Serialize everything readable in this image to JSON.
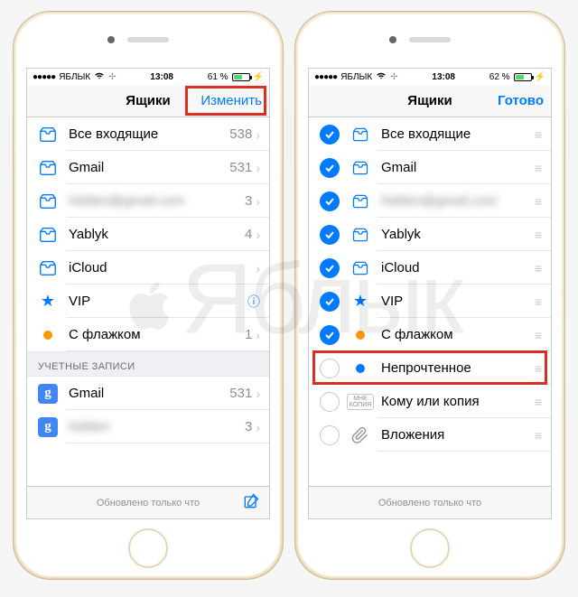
{
  "watermark": "Яблык",
  "left": {
    "status": {
      "carrier": "ЯБЛЫК",
      "time": "13:08",
      "battery": "61 %"
    },
    "nav": {
      "title": "Ящики",
      "right": "Изменить"
    },
    "mailboxes": [
      {
        "label": "Все входящие",
        "count": "538",
        "icon": "inbox"
      },
      {
        "label": "Gmail",
        "count": "531",
        "icon": "inbox"
      },
      {
        "label": "hidden@gmail.com",
        "count": "3",
        "icon": "inbox",
        "blurred": true
      },
      {
        "label": "Yablyk",
        "count": "4",
        "icon": "inbox"
      },
      {
        "label": "iCloud",
        "count": "",
        "icon": "inbox"
      },
      {
        "label": "VIP",
        "count": "",
        "icon": "star"
      },
      {
        "label": "С флажком",
        "count": "1",
        "icon": "flag"
      }
    ],
    "accounts_header": "УЧЕТНЫЕ ЗАПИСИ",
    "accounts": [
      {
        "label": "Gmail",
        "count": "531"
      },
      {
        "label": "hidden",
        "count": "3",
        "blurred": true
      }
    ],
    "toolbar": {
      "status": "Обновлено только что"
    }
  },
  "right": {
    "status": {
      "carrier": "ЯБЛЫК",
      "time": "13:08",
      "battery": "62 %"
    },
    "nav": {
      "title": "Ящики",
      "right": "Готово"
    },
    "items": [
      {
        "label": "Все входящие",
        "icon": "inbox",
        "checked": true
      },
      {
        "label": "Gmail",
        "icon": "inbox",
        "checked": true
      },
      {
        "label": "hidden@gmail.com",
        "icon": "inbox",
        "checked": true,
        "blurred": true
      },
      {
        "label": "Yablyk",
        "icon": "inbox",
        "checked": true
      },
      {
        "label": "iCloud",
        "icon": "inbox",
        "checked": true
      },
      {
        "label": "VIP",
        "icon": "star",
        "checked": true
      },
      {
        "label": "С флажком",
        "icon": "flag",
        "checked": true
      },
      {
        "label": "Непрочтенное",
        "icon": "dot",
        "checked": false,
        "highlight": true
      },
      {
        "label": "Кому или копия",
        "icon": "tocc",
        "checked": false
      },
      {
        "label": "Вложения",
        "icon": "attach",
        "checked": false
      }
    ],
    "toolbar": {
      "status": "Обновлено только что"
    }
  }
}
